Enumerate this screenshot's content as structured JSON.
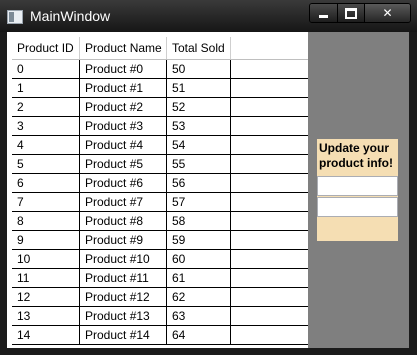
{
  "window": {
    "title": "MainWindow"
  },
  "caption": {
    "minimize": "minimize-icon",
    "maximize": "maximize-icon",
    "close": "✕"
  },
  "grid": {
    "headers": [
      "Product ID",
      "Product Name",
      "Total Sold"
    ],
    "rows": [
      [
        "0",
        "Product #0",
        "50"
      ],
      [
        "1",
        "Product #1",
        "51"
      ],
      [
        "2",
        "Product #2",
        "52"
      ],
      [
        "3",
        "Product #3",
        "53"
      ],
      [
        "4",
        "Product #4",
        "54"
      ],
      [
        "5",
        "Product #5",
        "55"
      ],
      [
        "6",
        "Product #6",
        "56"
      ],
      [
        "7",
        "Product #7",
        "57"
      ],
      [
        "8",
        "Product #8",
        "58"
      ],
      [
        "9",
        "Product #9",
        "59"
      ],
      [
        "10",
        "Product #10",
        "60"
      ],
      [
        "11",
        "Product #11",
        "61"
      ],
      [
        "12",
        "Product #12",
        "62"
      ],
      [
        "13",
        "Product #13",
        "63"
      ],
      [
        "14",
        "Product #14",
        "64"
      ]
    ]
  },
  "panel": {
    "title": "Update your product info!",
    "field1_value": "",
    "field2_value": ""
  },
  "colors": {
    "client_bg": "#7f7f7f",
    "panel_bg": "#f5deb3",
    "titlebar": "#1b1b1b"
  }
}
